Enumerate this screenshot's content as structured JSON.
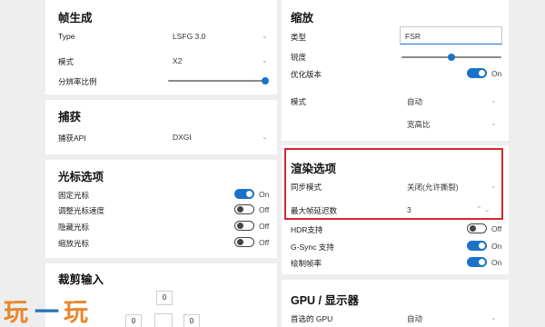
{
  "left": {
    "frame_gen": {
      "title": "帧生成",
      "type_label": "Type",
      "type_value": "LSFG 3.0",
      "mode_label": "模式",
      "mode_value": "X2",
      "scale_label": "分辨率比例",
      "scale_level_fraction": 1.0
    },
    "capture": {
      "title": "捕获",
      "api_label": "捕获API",
      "api_value": "DXGI"
    },
    "cursor": {
      "title": "光标选项",
      "items": [
        {
          "label": "固定光标",
          "state": "On",
          "on": true
        },
        {
          "label": "调整光标速度",
          "state": "Off",
          "on": false
        },
        {
          "label": "隐藏光标",
          "state": "Off",
          "on": false
        },
        {
          "label": "缩放光标",
          "state": "Off",
          "on": false
        }
      ]
    },
    "crop": {
      "title": "裁剪输入",
      "top_value": "0",
      "left_value": "0",
      "right_value": "0"
    }
  },
  "right": {
    "scaling": {
      "title": "缩放",
      "type_label": "类型",
      "type_value": "FSR",
      "sharpness_label": "锐度",
      "sharpness_fraction": 0.5,
      "optimized_label": "优化版本",
      "optimized_state": "On",
      "mode_label": "模式",
      "mode_value": "自动",
      "mode_sub_value": "宽高比"
    },
    "render": {
      "title": "渲染选项",
      "sync_label": "同步模式",
      "sync_value": "关闭(允许撕裂)",
      "max_frames_label": "最大帧延迟数",
      "max_frames_value": "3",
      "hdr_label": "HDR支持",
      "hdr_state": "Off",
      "gsync_label": "G-Sync 支持",
      "gsync_state": "On",
      "draw_fps_label": "绘制帧率",
      "draw_fps_state": "On"
    },
    "gpu": {
      "title": "GPU / 显示器",
      "preferred_label": "首选的 GPU",
      "preferred_value": "自动"
    }
  },
  "watermark": {
    "text_a": "玩",
    "text_b": "一",
    "text_c": "玩"
  },
  "colors": {
    "accent": "#1a73c8",
    "highlight_box": "#d9262c",
    "watermark_orange": "#e8862a",
    "watermark_blue": "#2a6fb5"
  }
}
